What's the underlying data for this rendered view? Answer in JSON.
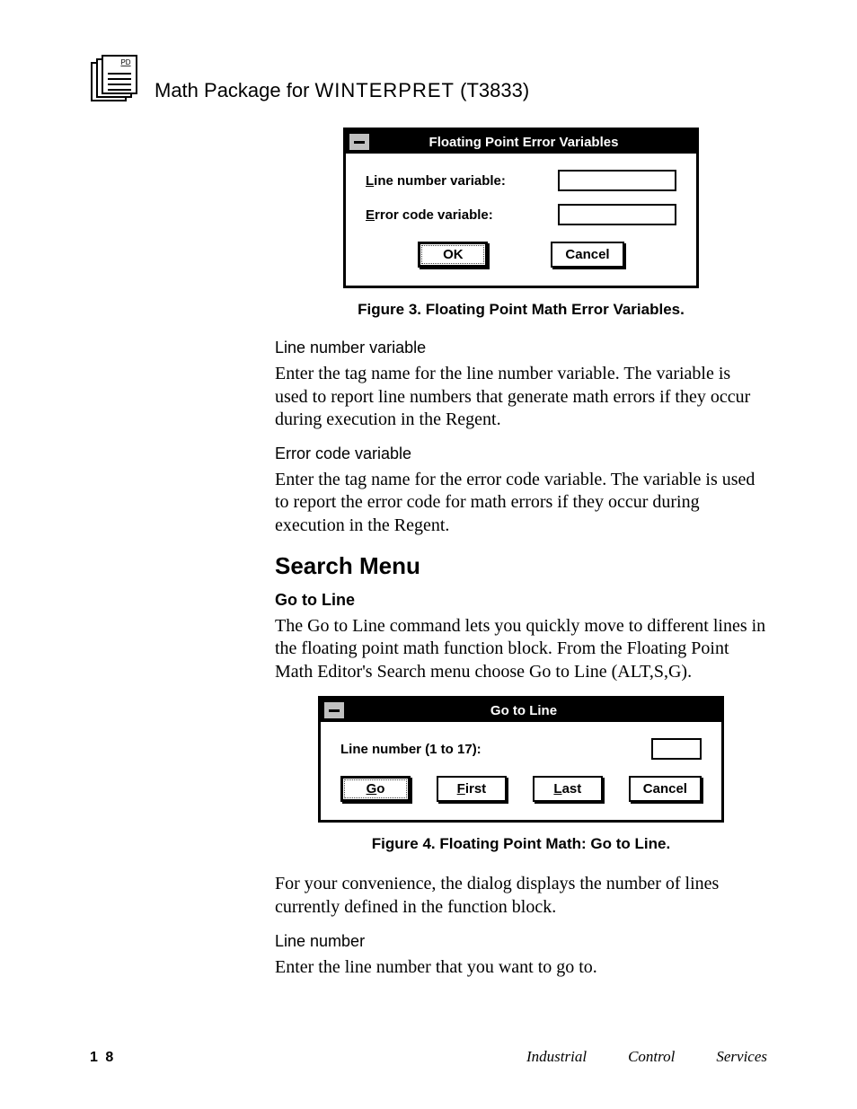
{
  "header": {
    "title_prefix": "Math  Package  for ",
    "title_product": "WINTERPRET",
    "title_suffix": " (T3833)",
    "logo_label": "PD"
  },
  "dialog1": {
    "title": "Floating Point Error Variables",
    "field1_leading": "L",
    "field1_rest": "ine number variable:",
    "field2_leading": "E",
    "field2_rest": "rror code variable:",
    "ok": "OK",
    "cancel": "Cancel"
  },
  "fig3": "Figure 3.  Floating Point Math Error Variables.",
  "sec1": {
    "h1": "Line number variable",
    "p1": "Enter the tag name for the line number variable. The variable is used to report line numbers that generate math errors if they occur during execution in the Regent.",
    "h2": "Error code variable",
    "p2": "Enter the tag name for the error code variable. The variable is used to report the error code for math errors if they occur during execution in the Regent."
  },
  "search": {
    "heading": "Search Menu",
    "sub": "Go to Line",
    "p1": "The Go to Line command lets you quickly move to different lines in the floating point math function block.  From the Floating Point Math Editor's Search menu choose Go to Line ",
    "shortcut": "(ALT,S,G)."
  },
  "dialog2": {
    "title": "Go to Line",
    "label": "Line number (1 to 17):",
    "go_u": "G",
    "go_r": "o",
    "first_u": "F",
    "first_r": "irst",
    "last_u": "L",
    "last_r": "ast",
    "cancel": "Cancel"
  },
  "fig4": "Figure 4.  Floating Point Math: Go to Line.",
  "sec2": {
    "p1": "For your convenience, the dialog displays the number of lines currently defined in the function block.",
    "h1": "Line number",
    "p2": "Enter the line number that you want to go to."
  },
  "footer": {
    "page": "1 8",
    "r1": "Industrial",
    "r2": "Control",
    "r3": "Services"
  }
}
